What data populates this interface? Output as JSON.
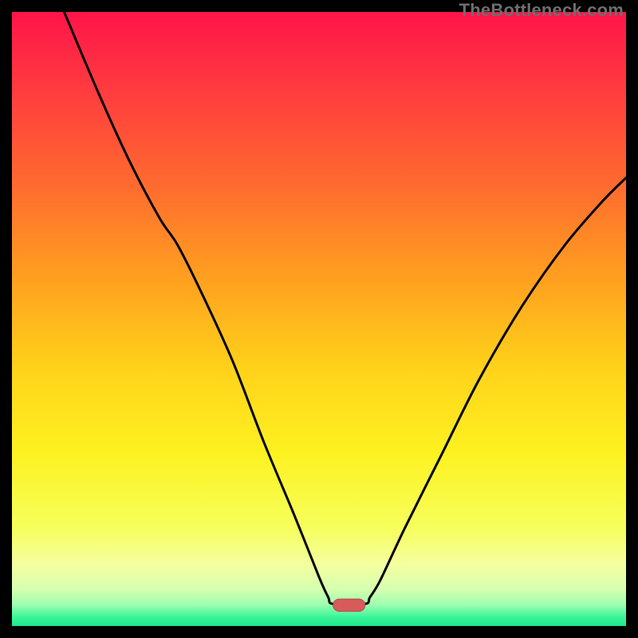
{
  "watermark": "TheBottleneck.com",
  "colors": {
    "black": "#000000",
    "curve": "#000000",
    "pill_fill": "#d85a5a",
    "pill_stroke": "#b74848",
    "gradient_stops": [
      {
        "offset": 0.0,
        "color": "#ff1449"
      },
      {
        "offset": 0.12,
        "color": "#ff3940"
      },
      {
        "offset": 0.28,
        "color": "#ff6a2f"
      },
      {
        "offset": 0.44,
        "color": "#ffa21f"
      },
      {
        "offset": 0.58,
        "color": "#ffd21a"
      },
      {
        "offset": 0.72,
        "color": "#fdf221"
      },
      {
        "offset": 0.84,
        "color": "#f6ff5c"
      },
      {
        "offset": 0.9,
        "color": "#f5ffa0"
      },
      {
        "offset": 0.94,
        "color": "#d6ffb0"
      },
      {
        "offset": 0.965,
        "color": "#9effb0"
      },
      {
        "offset": 0.985,
        "color": "#3cf59a"
      },
      {
        "offset": 1.0,
        "color": "#19e88c"
      }
    ]
  },
  "chart_data": {
    "type": "line",
    "title": "",
    "xlabel": "",
    "ylabel": "",
    "xlim": [
      0,
      100
    ],
    "ylim": [
      0,
      100
    ],
    "note": "Values in pixel-normalized space (0=left/top, 100=right/bottom on inverted y). The curve appears to show bottleneck percentage: high on edges, dipping to ~0 around x≈52-56.",
    "series": [
      {
        "name": "bottleneck-curve",
        "points": [
          {
            "x": 8.5,
            "y": 0
          },
          {
            "x": 14,
            "y": 13
          },
          {
            "x": 19,
            "y": 24
          },
          {
            "x": 24,
            "y": 33.5
          },
          {
            "x": 27,
            "y": 38
          },
          {
            "x": 31,
            "y": 46
          },
          {
            "x": 36,
            "y": 57
          },
          {
            "x": 41,
            "y": 70
          },
          {
            "x": 46,
            "y": 82
          },
          {
            "x": 50,
            "y": 92
          },
          {
            "x": 51.5,
            "y": 95.3
          },
          {
            "x": 52.3,
            "y": 96.4
          },
          {
            "x": 57.5,
            "y": 96.4
          },
          {
            "x": 58.3,
            "y": 95.3
          },
          {
            "x": 60,
            "y": 92.5
          },
          {
            "x": 64,
            "y": 84
          },
          {
            "x": 70,
            "y": 72
          },
          {
            "x": 76,
            "y": 60
          },
          {
            "x": 83,
            "y": 48
          },
          {
            "x": 90,
            "y": 38
          },
          {
            "x": 96,
            "y": 31
          },
          {
            "x": 100,
            "y": 27
          }
        ]
      }
    ],
    "marker": {
      "name": "optimal-zone-pill",
      "x_center": 54.9,
      "y_center": 96.6,
      "width": 5.2,
      "height": 2.0
    }
  }
}
